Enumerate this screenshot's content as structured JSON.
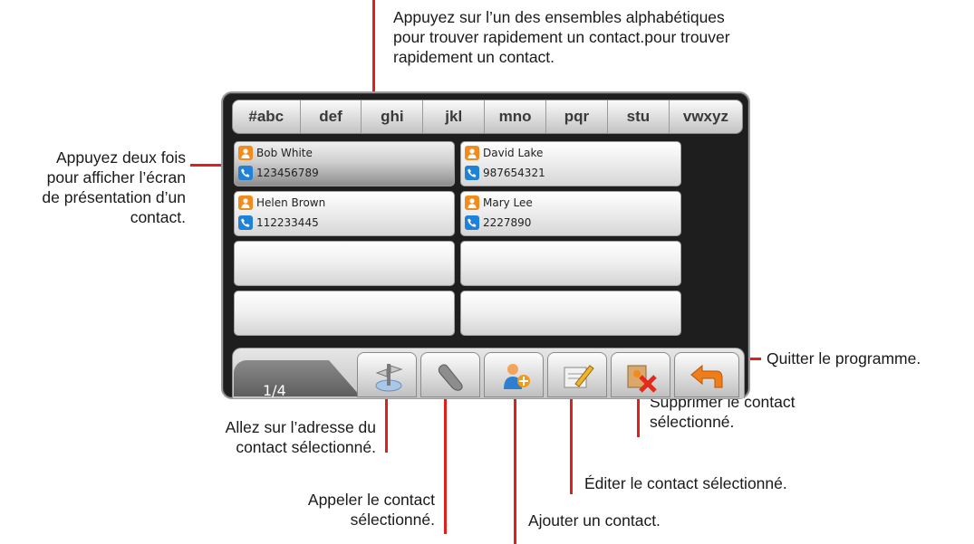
{
  "callouts": {
    "alpha_sets": [
      "Appuyez sur l’un des ensembles alphabétiques",
      "pour trouver rapidement un contact.pour trouver",
      "rapidement un contact."
    ],
    "double_tap": [
      "Appuyez deux fois",
      "pour afficher l’écran",
      "de présentation d’un",
      "contact."
    ],
    "quit": "Quitter le programme.",
    "goto_address": [
      "Allez sur l’adresse du",
      "contact sélectionné."
    ],
    "delete": [
      "Supprimer le contact",
      "sélectionné."
    ],
    "edit": "Éditer le contact sélectionné.",
    "call": [
      "Appeler le contact",
      "sélectionné."
    ],
    "add": "Ajouter un contact."
  },
  "alphabet_tabs": [
    "#abc",
    "def",
    "ghi",
    "jkl",
    "mno",
    "pqr",
    "stu",
    "vwxyz"
  ],
  "contacts": [
    {
      "name": "Bob White",
      "phone": "123456789"
    },
    {
      "name": "David Lake",
      "phone": "987654321"
    },
    {
      "name": "Helen Brown",
      "phone": "112233445"
    },
    {
      "name": "Mary Lee",
      "phone": "2227890"
    }
  ],
  "pager": {
    "label": "1/4"
  },
  "toolbar_buttons": [
    "navigate-icon",
    "phone-handset-icon",
    "add-person-icon",
    "edit-pencil-icon",
    "delete-contact-icon",
    "back-arrow-icon"
  ],
  "colors": {
    "callout_line": "#e0201b",
    "person_icon": "#f08b1e",
    "phone_icon": "#1f82d6",
    "delete_x": "#e32a1d",
    "back_arrow": "#f07d1a"
  }
}
